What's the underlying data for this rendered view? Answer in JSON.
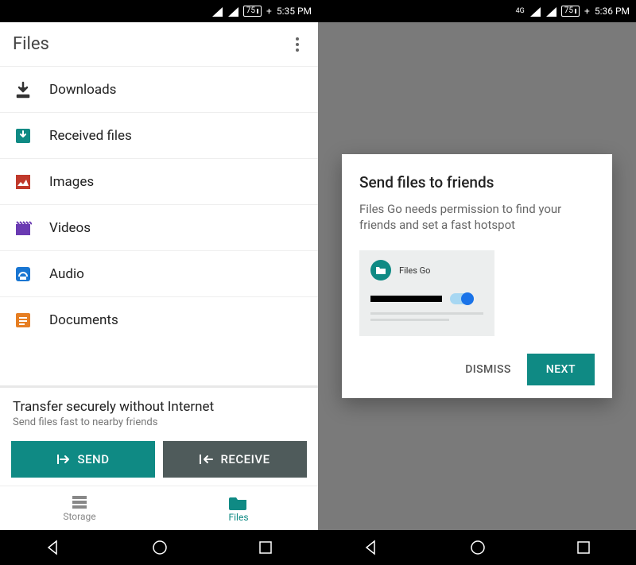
{
  "left": {
    "statusbar": {
      "battery": "75",
      "time": "5:35 PM",
      "network_tag": ""
    },
    "appbar": {
      "title": "Files"
    },
    "categories": [
      {
        "label": "Downloads",
        "icon": "download-icon",
        "color": "#333"
      },
      {
        "label": "Received files",
        "icon": "inbox-icon",
        "color": "#0f8a84"
      },
      {
        "label": "Images",
        "icon": "image-icon",
        "color": "#c0392b"
      },
      {
        "label": "Videos",
        "icon": "video-icon",
        "color": "#6a3ab2"
      },
      {
        "label": "Audio",
        "icon": "audio-icon",
        "color": "#1976d2"
      },
      {
        "label": "Documents",
        "icon": "document-icon",
        "color": "#e67e22"
      }
    ],
    "transfer": {
      "title": "Transfer securely without Internet",
      "subtitle": "Send files fast to nearby friends",
      "send_label": "SEND",
      "receive_label": "RECEIVE"
    },
    "tabs": {
      "storage": "Storage",
      "files": "Files"
    }
  },
  "right": {
    "statusbar": {
      "battery": "75",
      "time": "5:36 PM",
      "network_tag": "4G"
    },
    "dialog": {
      "title": "Send files to friends",
      "body": "Files Go needs permission to find your friends and set a fast hotspot",
      "app_name": "Files Go",
      "dismiss_label": "DISMISS",
      "next_label": "NEXT"
    }
  }
}
